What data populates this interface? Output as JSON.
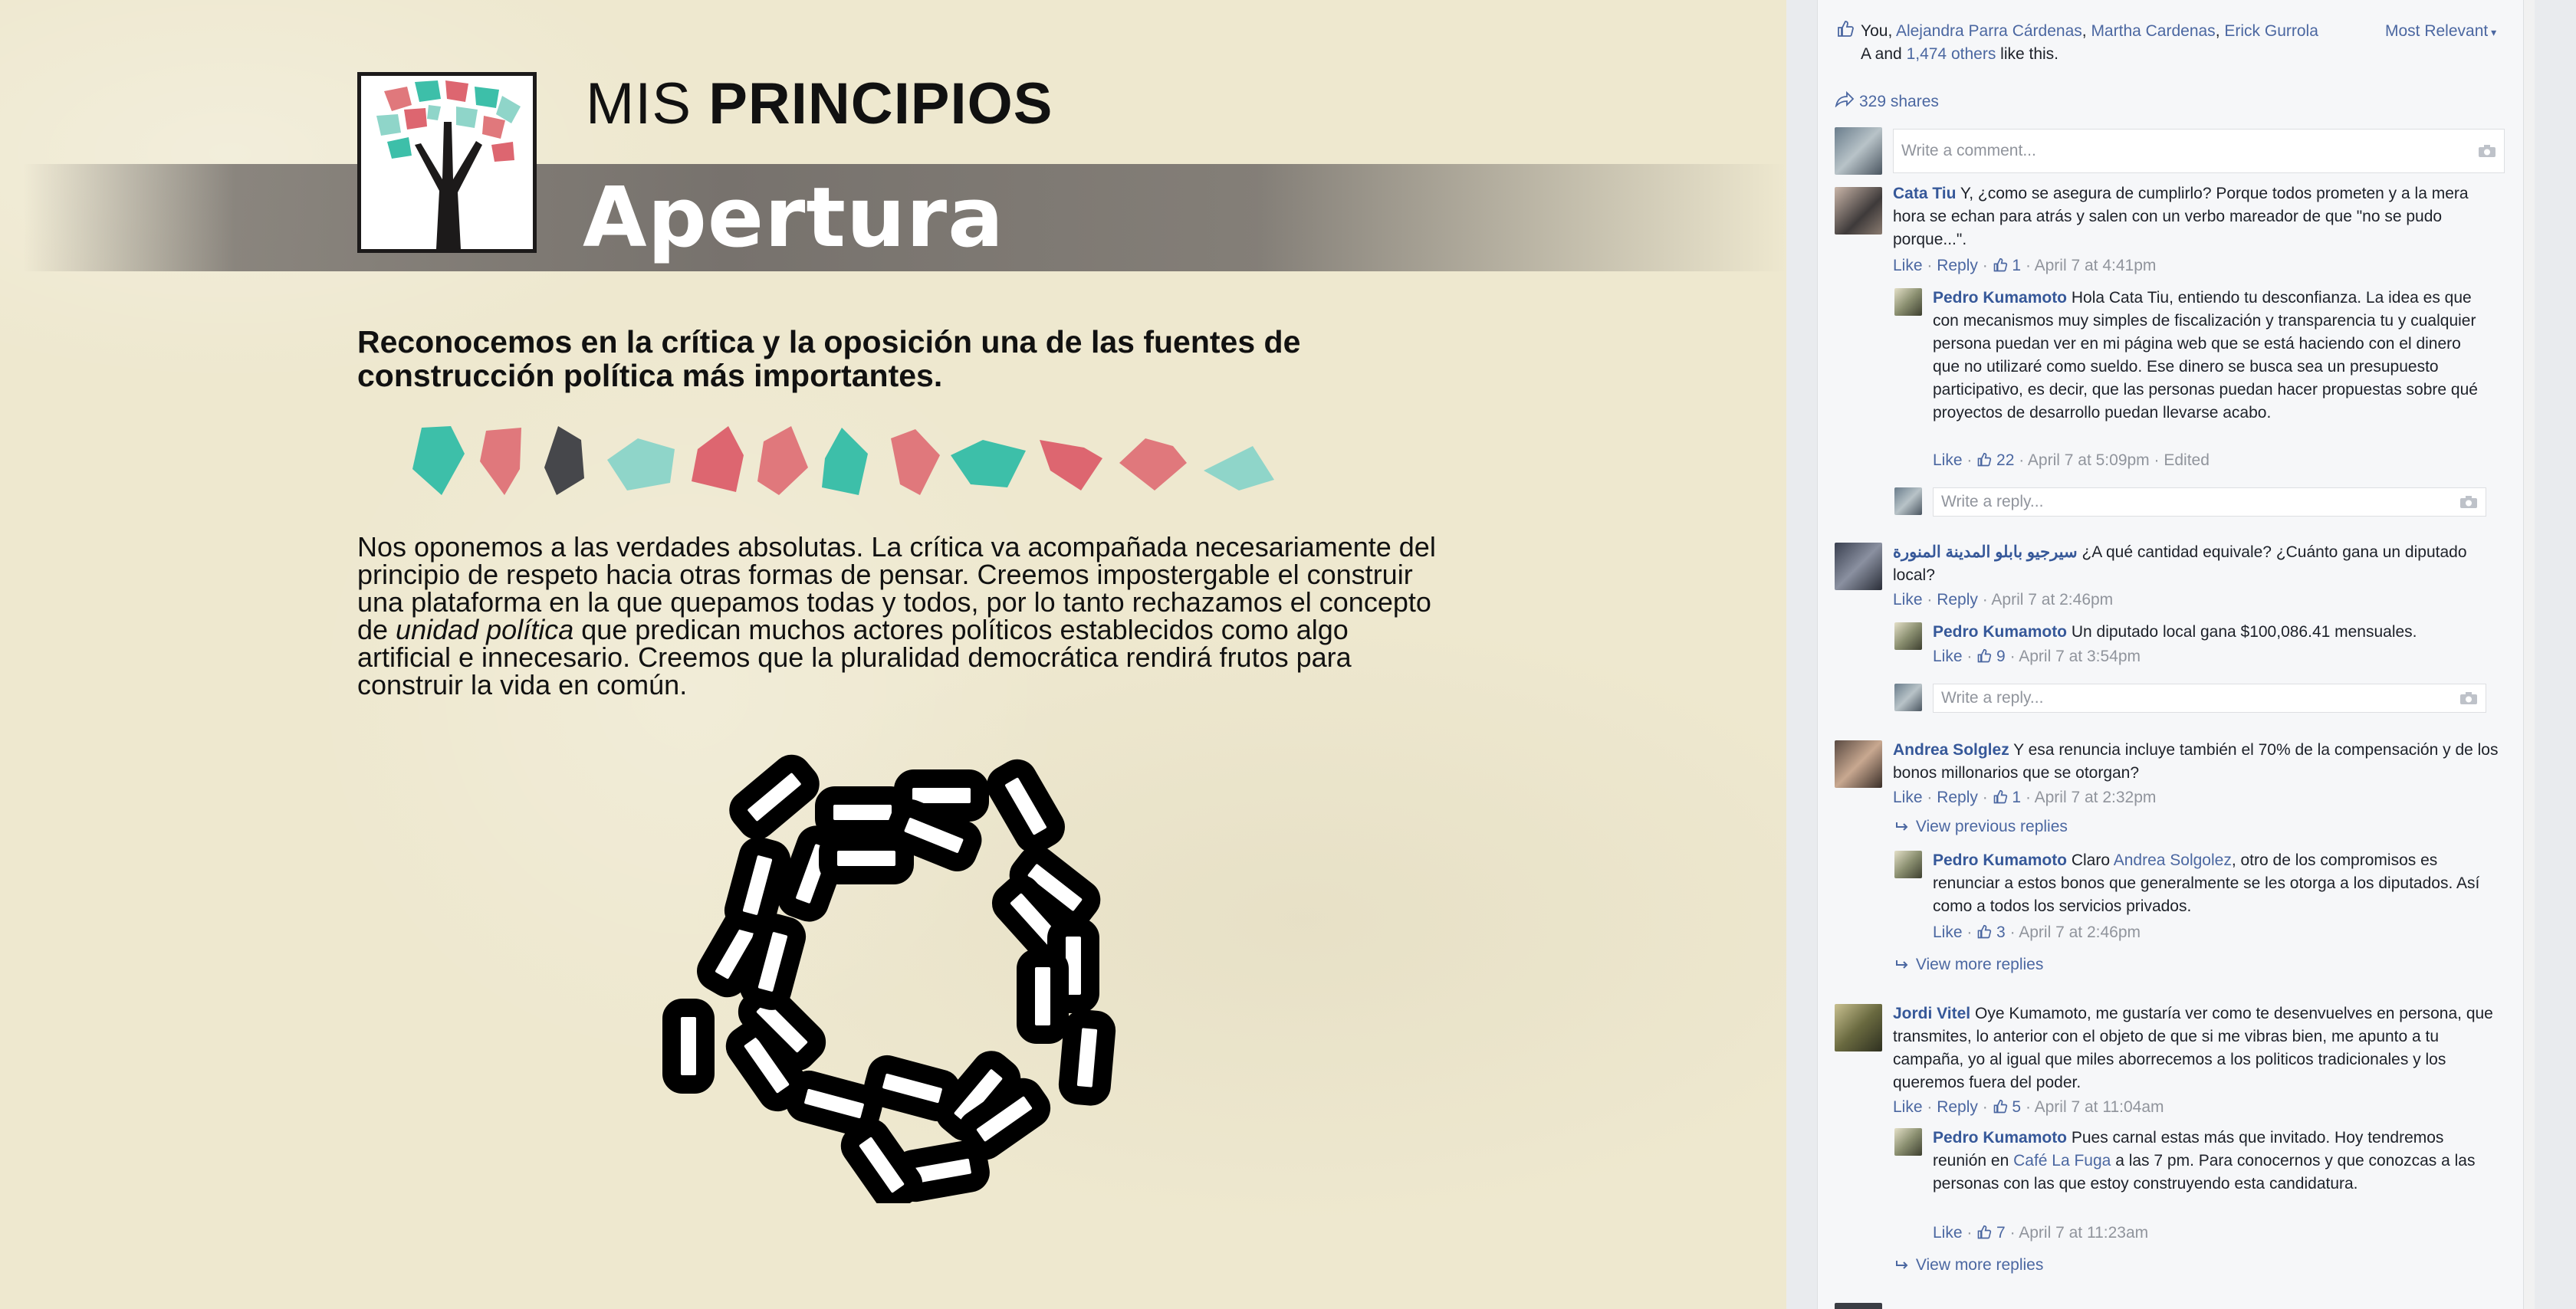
{
  "poster": {
    "brand_thin": "MIS ",
    "brand_bold": "PRINCIPIOS",
    "section_title": "Apertura",
    "lead": "Reconocemos en la crítica y la oposición una de las fuentes de construcción política más importantes.",
    "body_1": "Nos oponemos a las verdades absolutas. La crítica va acompañada necesariamente del principio de respeto hacia otras formas de pensar. Creemos impostergable el construir una plataforma en la que quepamos todas y todos, por lo tanto rechazamos el concepto de ",
    "body_italic": "unidad política",
    "body_2": " que predican muchos actores políticos establecidos como algo artificial e innecesario. Creemos que la pluralidad democrática rendirá frutos para construir la vida en común.",
    "colors": {
      "teal": "#3dbfa9",
      "pink": "#e0787c",
      "red": "#dd6670",
      "charcoal": "#46474b",
      "mint": "#8fd5c9"
    }
  },
  "fb": {
    "likes": {
      "you": "You, ",
      "n1": "Alejandra Parra Cárdenas",
      "sep1": ", ",
      "n2": "Martha Cardenas",
      "sep2": ", ",
      "n3": "Erick Gurrola",
      "line2a": "A and ",
      "others": "1,474 others",
      "line2b": " like this.",
      "sort": "Most Relevant"
    },
    "shares": "329 shares",
    "write_comment": "Write a comment...",
    "write_reply": "Write a reply...",
    "comments": [
      {
        "name": "Cata Tiu",
        "text": " Y, ¿como se asegura de cumplirlo? Porque todos prometen y a la mera hora se echan para atrás y salen con un verbo mareador de que \"no se pudo porque...\".",
        "like": "Like",
        "reply": "Reply",
        "count": "1",
        "time": "April 7 at 4:41pm",
        "replies": [
          {
            "name": "Pedro Kumamoto",
            "text": " Hola Cata Tiu, entiendo tu desconfianza. La idea es que con mecanismos muy simples de fiscalización y transparencia tu y cualquier persona puedan ver en mi página web que se está haciendo con el dinero que no utilizaré como sueldo. Ese dinero se busca sea un presupuesto participativo, es decir, que las personas puedan hacer propuestas sobre qué proyectos de desarrollo puedan llevarse acabo.",
            "like": "Like",
            "count": "22",
            "time": "April 7 at 5:09pm",
            "edited": "Edited"
          }
        ]
      },
      {
        "name": "سيرجيو بابلو المدينة المنورة",
        "text": " ¿A qué cantidad equivale? ¿Cuánto gana un diputado local?",
        "like": "Like",
        "reply": "Reply",
        "time": "April 7 at 2:46pm",
        "replies": [
          {
            "name": "Pedro Kumamoto",
            "text": " Un diputado local gana $100,086.41 mensuales.",
            "like": "Like",
            "count": "9",
            "time": "April 7 at 3:54pm"
          }
        ]
      },
      {
        "name": "Andrea Solglez",
        "text": " Y esa renuncia incluye también el 70% de la compensación y de los bonos millonarios que se otorgan?",
        "like": "Like",
        "reply": "Reply",
        "count": "1",
        "time": "April 7 at 2:32pm",
        "view_previous": "View previous replies",
        "replies": [
          {
            "name": "Pedro Kumamoto",
            "text_a": " Claro ",
            "mention": "Andrea Solgolez",
            "text_b": ", otro de los compromisos es renunciar a estos bonos que generalmente se les otorga a los diputados. Así como a todos los servicios privados.",
            "like": "Like",
            "count": "3",
            "time": "April 7 at 2:46pm"
          }
        ],
        "view_more": "View more replies"
      },
      {
        "name": "Jordi Vitel",
        "text": " Oye Kumamoto, me gustaría ver como te desenvuelves en persona, que transmites, lo anterior con el objeto de que si me vibras bien, me apunto a tu campaña, yo al igual que miles aborrecemos a los politicos tradicionales y los queremos fuera del poder.",
        "like": "Like",
        "reply": "Reply",
        "count": "5",
        "time": "April 7 at 11:04am",
        "replies": [
          {
            "name": "Pedro Kumamoto",
            "text_a": " Pues carnal estas más que invitado. Hoy tendremos reunión en ",
            "mention": "Café La Fuga",
            "text_b": " a las 7 pm. Para conocernos y que conozcas a las personas con las que estoy construyendo esta candidatura.",
            "like": "Like",
            "count": "7",
            "time": "April 7 at 11:23am"
          }
        ],
        "view_more": "View more replies"
      }
    ]
  }
}
